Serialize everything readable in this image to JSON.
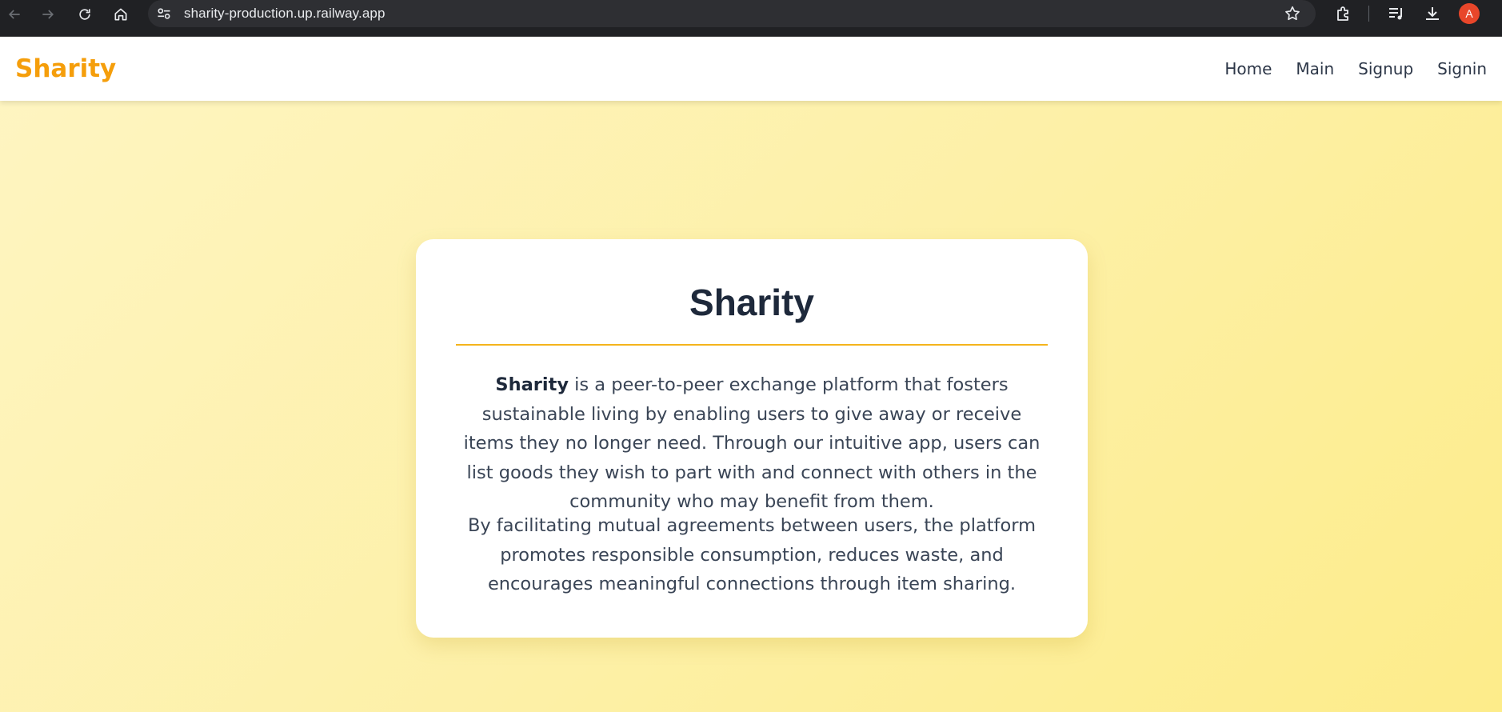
{
  "browser": {
    "url": "sharity-production.up.railway.app",
    "profile_initial": "A",
    "icons": [
      "back-icon",
      "forward-icon",
      "reload-icon",
      "home-icon",
      "site-info-icon",
      "bookmark-star-icon",
      "extensions-icon",
      "media-queue-icon",
      "download-icon"
    ]
  },
  "header": {
    "brand": "Sharity",
    "nav": [
      {
        "label": "Home"
      },
      {
        "label": "Main"
      },
      {
        "label": "Signup"
      },
      {
        "label": "Signin"
      }
    ]
  },
  "card": {
    "title": "Sharity",
    "para1_bold": "Sharity",
    "para1_rest": " is a peer-to-peer exchange platform that fosters sustainable living by enabling users to give away or receive items they no longer need. Through our intuitive app, users can list goods they wish to part with and connect with others in the community who may benefit from them.",
    "para2": "By facilitating mutual agreements between users, the platform promotes responsible consumption, reduces waste, and encourages meaningful connections through item sharing."
  },
  "colors": {
    "brand": "#f59e0b",
    "accent_rule": "#f5b41c",
    "background": "#fdf0a6",
    "text": "#3a4556"
  }
}
